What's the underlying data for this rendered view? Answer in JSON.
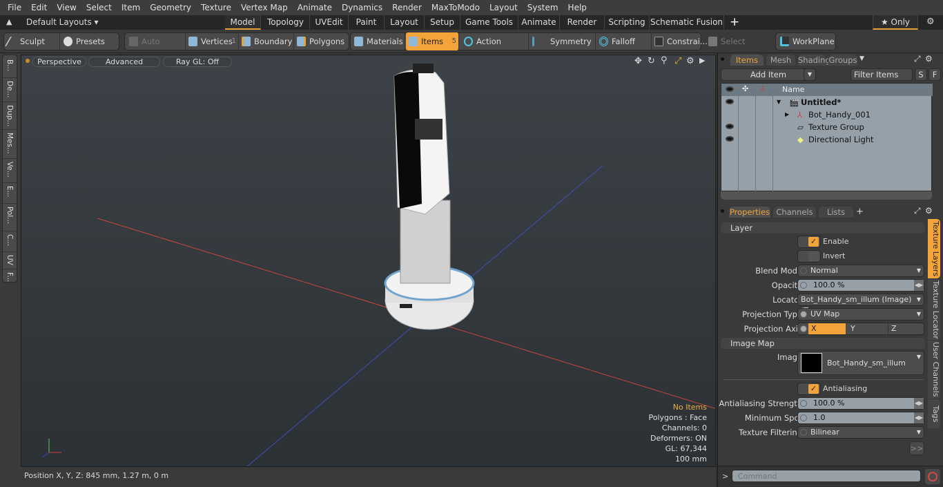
{
  "menu": [
    "File",
    "Edit",
    "View",
    "Select",
    "Item",
    "Geometry",
    "Texture",
    "Vertex Map",
    "Animate",
    "Dynamics",
    "Render",
    "MaxToModo",
    "Layout",
    "System",
    "Help"
  ],
  "layouts": {
    "label": "Default Layouts ▾",
    "tabs": [
      "Model",
      "Topology",
      "UVEdit",
      "Paint",
      "Layout",
      "Setup",
      "Game Tools",
      "Animate",
      "Render",
      "Scripting",
      "Schematic Fusion"
    ],
    "add": "+",
    "only": "★ Only",
    "active_tab": "Model"
  },
  "toolbar": {
    "sculpt": "Sculpt",
    "presets": "Presets",
    "auto_select": "Auto Select",
    "vertices": "Vertices",
    "vertices_count": "1",
    "boundary": "Boundary",
    "polygons": "Polygons",
    "materials": "Materials",
    "items": "Items",
    "items_count": "5",
    "action_center": "Action Center",
    "symmetry": "Symmetry",
    "falloff": "Falloff",
    "constraints": "Constrai...",
    "select_through": "Select Through",
    "workplane": "WorkPlane"
  },
  "left_tabs": [
    "B...",
    "De...",
    "Dup...",
    "Mes...",
    "Ve...",
    "E...",
    "Pol...",
    "C...",
    "UV",
    "F..."
  ],
  "viewport": {
    "perspective": "Perspective",
    "advanced": "Advanced",
    "raygl": "Ray GL: Off",
    "info": {
      "no_items": "No Items",
      "polygons": "Polygons : Face",
      "channels": "Channels: 0",
      "deformers": "Deformers: ON",
      "gl": "GL: 67,344",
      "scale": "100 mm"
    }
  },
  "status": {
    "position": "Position X, Y, Z:  845 mm, 1.27 m, 0 m"
  },
  "items_panel": {
    "tabs": [
      "Items",
      "Mesh ...",
      "Shading",
      "Groups"
    ],
    "add_item": "Add Item",
    "filter": "Filter Items",
    "s": "S",
    "f": "F",
    "name_header": "Name",
    "rows": [
      {
        "name": "Untitled*",
        "visible": true
      },
      {
        "name": "Bot_Handy_001",
        "visible": false
      },
      {
        "name": "Texture Group",
        "visible": true
      },
      {
        "name": "Directional Light",
        "visible": true
      }
    ]
  },
  "properties": {
    "tabs": [
      "Properties",
      "Channels",
      "Lists",
      "+"
    ],
    "side_tabs": [
      "Texture Layers",
      "Texture Locator",
      "User Channels",
      "Tags"
    ],
    "layer_section": "Layer",
    "enable": "Enable",
    "invert": "Invert",
    "blend_mode_label": "Blend Mode",
    "blend_mode": "Normal",
    "opacity_label": "Opacity",
    "opacity": "100.0 %",
    "locator_label": "Locator",
    "locator": "Bot_Handy_sm_illum (Image) (T...",
    "projection_type_label": "Projection Type",
    "projection_type": "UV Map",
    "projection_axis_label": "Projection Axis",
    "axes": [
      "X",
      "Y",
      "Z"
    ],
    "projection_axis": "X",
    "image_map_section": "Image Map",
    "image_label": "Image",
    "image": "Bot_Handy_sm_illum",
    "antialiasing": "Antialiasing",
    "aa_strength_label": "Antialiasing Strength",
    "aa_strength": "100.0 %",
    "min_spot_label": "Minimum Spot",
    "min_spot": "1.0",
    "filtering_label": "Texture Filtering",
    "filtering": "Bilinear",
    "more": ">>"
  },
  "command": {
    "placeholder": "Command",
    "prompt": ">"
  },
  "colors": {
    "accent": "#f2a33a",
    "x_axis": "#c8483a",
    "z_axis": "#3c4fb8"
  }
}
